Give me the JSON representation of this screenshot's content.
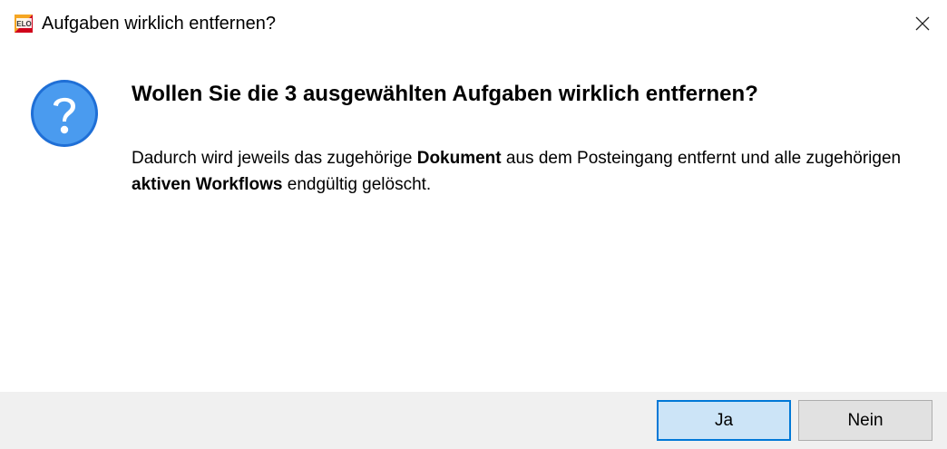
{
  "window": {
    "title": "Aufgaben wirklich entfernen?",
    "app_icon_text": "ELO",
    "close_icon": "close-icon"
  },
  "dialog": {
    "icon": "question-icon",
    "icon_color": "#3c8ee6",
    "heading": "Wollen Sie die 3 ausgewählten Aufgaben wirklich entfernen?",
    "message": {
      "part1": "Dadurch wird jeweils das zugehörige ",
      "bold1": "Dokument",
      "part2": " aus dem Posteingang entfernt und alle zugehörigen ",
      "bold2": "aktiven Workflows",
      "part3": " endgültig gelöscht."
    }
  },
  "buttons": {
    "yes_label": "Ja",
    "no_label": "Nein",
    "accent_color": "#0078d7"
  }
}
